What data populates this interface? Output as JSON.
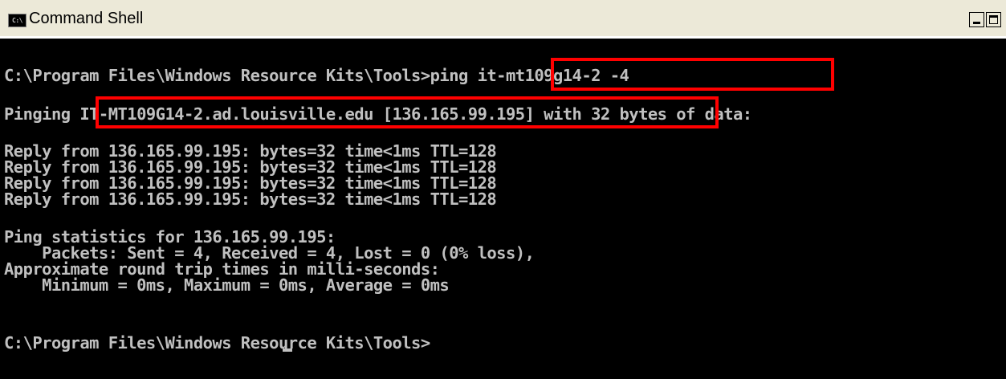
{
  "window": {
    "title": "Command Shell",
    "icon_label": "C:\\"
  },
  "console": {
    "lines": [
      "C:\\Program Files\\Windows Resource Kits\\Tools>ping it-mt109g14-2 -4",
      "Pinging IT-MT109G14-2.ad.louisville.edu [136.165.99.195] with 32 bytes of data:",
      "Reply from 136.165.99.195: bytes=32 time<1ms TTL=128",
      "Reply from 136.165.99.195: bytes=32 time<1ms TTL=128",
      "Reply from 136.165.99.195: bytes=32 time<1ms TTL=128",
      "Reply from 136.165.99.195: bytes=32 time<1ms TTL=128",
      "Ping statistics for 136.165.99.195:",
      "    Packets: Sent = 4, Received = 4, Lost = 0 (0% loss),",
      "Approximate round trip times in milli-seconds:",
      "    Minimum = 0ms, Maximum = 0ms, Average = 0ms",
      "C:\\Program Files\\Windows Resource Kits\\Tools>"
    ],
    "highlight_color": "#ff0000",
    "text_color": "#c0c0c0",
    "background_color": "#000000"
  }
}
